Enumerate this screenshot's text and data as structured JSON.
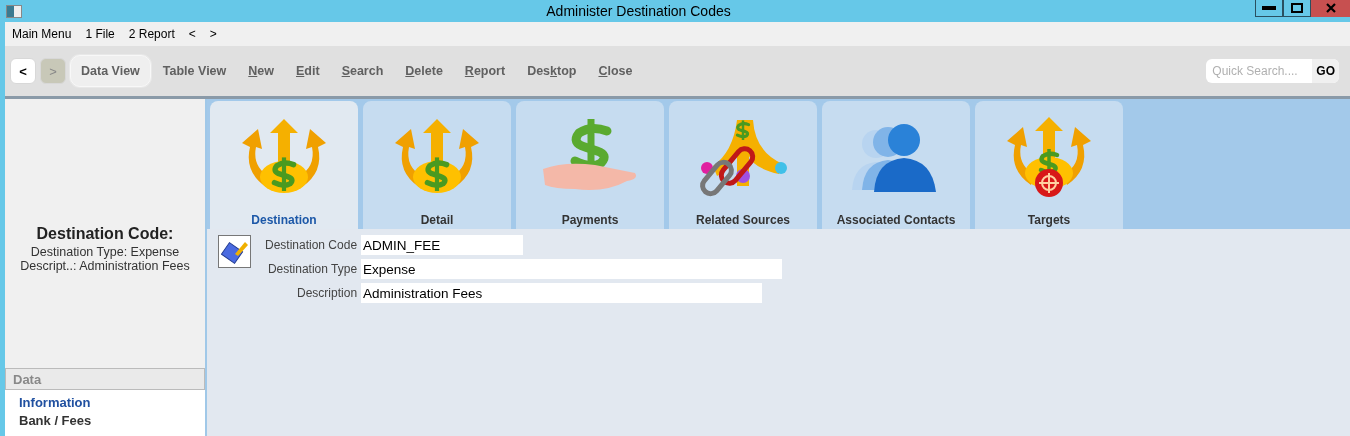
{
  "window": {
    "title": "Administer Destination Codes"
  },
  "menu_bar": [
    "Main Menu",
    "1 File",
    "2 Report",
    "<",
    ">"
  ],
  "toolbar": {
    "back": {
      "label": "<",
      "disabled": false
    },
    "forward": {
      "label": ">",
      "disabled": true
    },
    "buttons": [
      {
        "parts": [
          {
            "text": "Data View",
            "underlined": false
          }
        ],
        "selected": true
      },
      {
        "parts": [
          {
            "text": "Table View",
            "underlined": false
          }
        ],
        "selected": false
      },
      {
        "parts": [
          {
            "text": "N",
            "underlined": true
          },
          {
            "text": "ew",
            "underlined": false
          }
        ],
        "selected": false
      },
      {
        "parts": [
          {
            "text": "E",
            "underlined": true
          },
          {
            "text": "dit",
            "underlined": false
          }
        ],
        "selected": false
      },
      {
        "parts": [
          {
            "text": "S",
            "underlined": true
          },
          {
            "text": "earch",
            "underlined": false
          }
        ],
        "selected": false
      },
      {
        "parts": [
          {
            "text": "D",
            "underlined": true
          },
          {
            "text": "elete",
            "underlined": false
          }
        ],
        "selected": false
      },
      {
        "parts": [
          {
            "text": "R",
            "underlined": true
          },
          {
            "text": "eport",
            "underlined": false
          }
        ],
        "selected": false
      },
      {
        "parts": [
          {
            "text": "Des",
            "underlined": false
          },
          {
            "text": "k",
            "underlined": true
          },
          {
            "text": "top",
            "underlined": false
          }
        ],
        "selected": false
      },
      {
        "parts": [
          {
            "text": "C",
            "underlined": true
          },
          {
            "text": "lose",
            "underlined": false
          }
        ],
        "selected": false
      }
    ],
    "search": {
      "placeholder": "Quick Search....",
      "button": "GO"
    }
  },
  "summary": {
    "title": "Destination Code:",
    "lines": [
      "Destination Type: Expense",
      "Descript..: Administration Fees"
    ]
  },
  "nav": {
    "header": "Data",
    "items": [
      {
        "label": "Information",
        "selected": true
      },
      {
        "label": "Bank / Fees",
        "selected": false
      }
    ]
  },
  "tabs": [
    {
      "label": "Destination",
      "kind": "arrows",
      "selected": true
    },
    {
      "label": "Detail",
      "kind": "arrows",
      "selected": false
    },
    {
      "label": "Payments",
      "kind": "hand",
      "selected": false
    },
    {
      "label": "Related Sources",
      "kind": "chain",
      "selected": false
    },
    {
      "label": "Associated Contacts",
      "kind": "people",
      "selected": false
    },
    {
      "label": "Targets",
      "kind": "target",
      "selected": false
    }
  ],
  "form": {
    "fields": [
      {
        "label": "Destination Code",
        "value": "ADMIN_FEE"
      },
      {
        "label": "Destination Type",
        "value": "Expense"
      },
      {
        "label": "Description",
        "value": "Administration Fees"
      }
    ]
  }
}
